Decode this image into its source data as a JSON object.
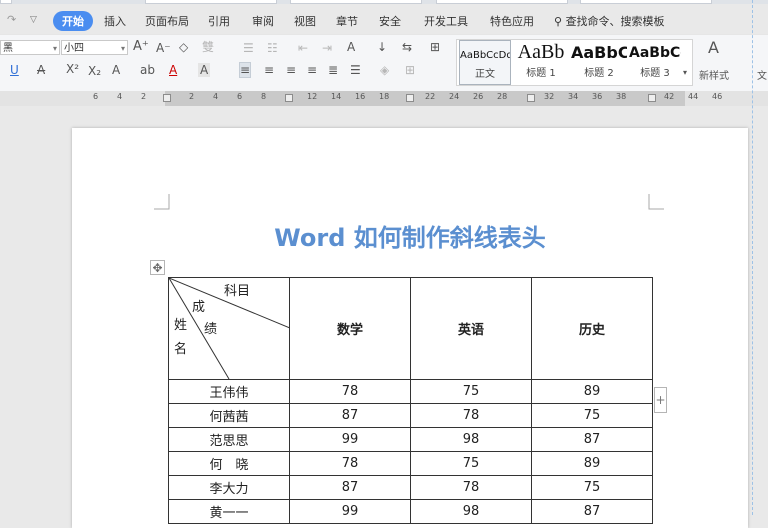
{
  "menu": {
    "items": [
      "开始",
      "插入",
      "页面布局",
      "引用",
      "审阅",
      "视图",
      "章节",
      "安全",
      "开发工具",
      "特色应用"
    ],
    "search_label": "查找命令、搜索模板"
  },
  "ribbon": {
    "font_name": "黑",
    "font_size": "小四",
    "styles": [
      {
        "preview": "AaBbCcDd",
        "name": "正文"
      },
      {
        "preview": "AaBb",
        "name": "标题 1"
      },
      {
        "preview": "AaBbC",
        "name": "标题 2"
      },
      {
        "preview": "AaBbCc",
        "name": "标题 3"
      }
    ],
    "new_style": "新样式",
    "cut_off_label": "文"
  },
  "ruler": {
    "ticks": [
      "6",
      "4",
      "2",
      "2",
      "4",
      "6",
      "8",
      "12",
      "14",
      "16",
      "18",
      "22",
      "24",
      "26",
      "28",
      "32",
      "34",
      "36",
      "38",
      "42",
      "44",
      "46"
    ]
  },
  "document": {
    "title": "Word 如何制作斜线表头",
    "header_cell": {
      "top": "科目",
      "middle_a": "成",
      "middle_b": "绩",
      "left_a": "姓",
      "left_b": "名"
    },
    "columns": [
      "数学",
      "英语",
      "历史"
    ],
    "rows": [
      {
        "name": "王伟伟",
        "values": [
          "78",
          "75",
          "89"
        ]
      },
      {
        "name": "何茜茜",
        "values": [
          "87",
          "78",
          "75"
        ]
      },
      {
        "name": "范思思",
        "values": [
          "99",
          "98",
          "87"
        ]
      },
      {
        "name": "何　晓",
        "values": [
          "78",
          "75",
          "89"
        ]
      },
      {
        "name": "李大力",
        "values": [
          "87",
          "78",
          "75"
        ]
      },
      {
        "name": "黄一一",
        "values": [
          "99",
          "98",
          "87"
        ]
      }
    ]
  },
  "colors": {
    "accent": "#4a8df0",
    "title": "#5b8fd0"
  }
}
